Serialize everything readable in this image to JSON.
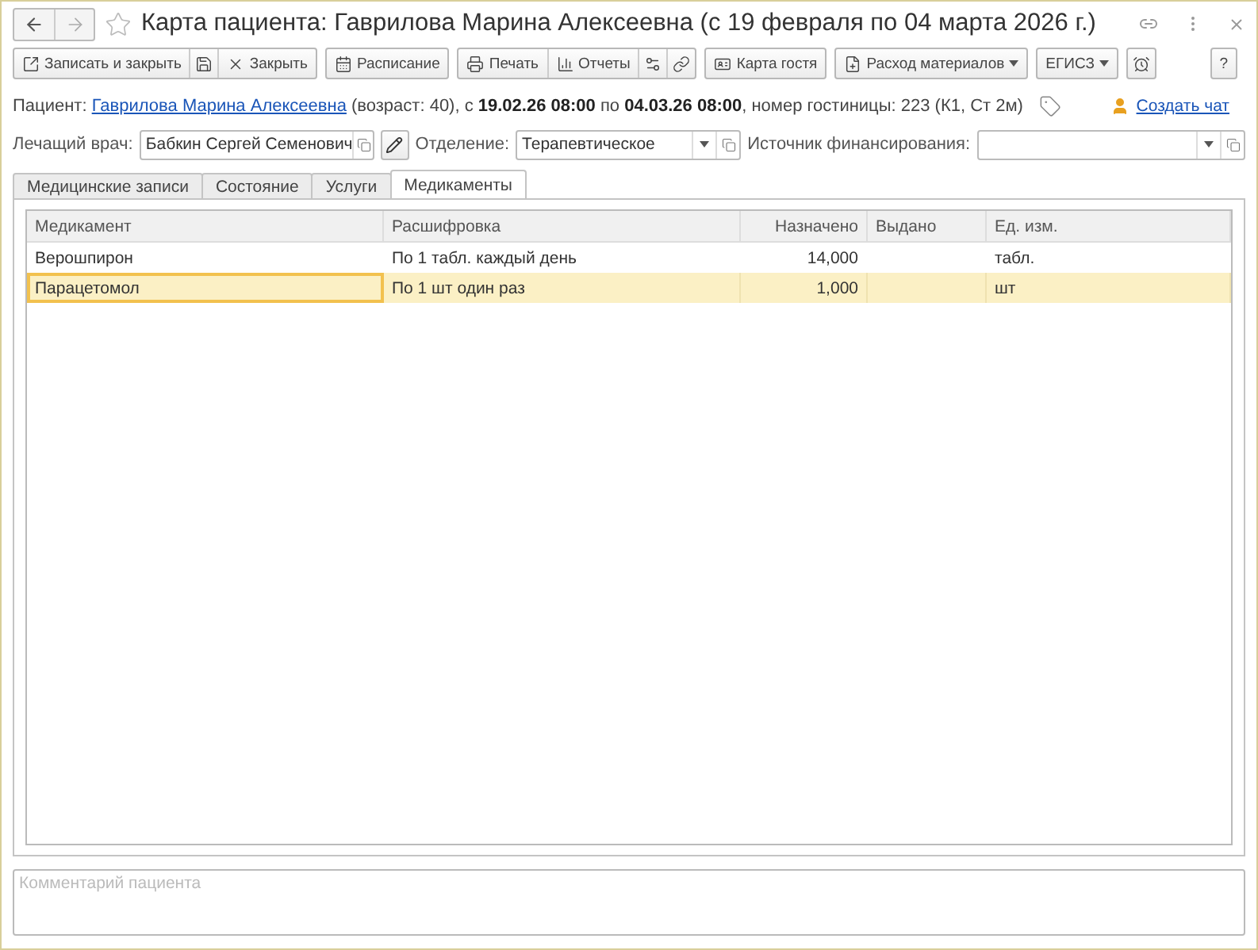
{
  "window": {
    "title": "Карта пациента: Гаврилова Марина Алексеевна (с 19 февраля по 04 марта 2026 г.)"
  },
  "toolbar": {
    "groups": [
      [
        {
          "kind": "button",
          "label": "Записать и закрыть"
        },
        {
          "kind": "icon"
        },
        {
          "kind": "button",
          "label": "Закрыть"
        }
      ],
      [
        {
          "kind": "button",
          "label": "Расписание"
        }
      ],
      [
        {
          "kind": "button",
          "label": "Печать"
        },
        {
          "kind": "button",
          "label": "Отчеты"
        },
        {
          "kind": "icon"
        },
        {
          "kind": "icon"
        }
      ],
      [
        {
          "kind": "button",
          "label": "Карта гостя"
        }
      ],
      [
        {
          "kind": "menu",
          "label": "Расход материалов"
        }
      ],
      [
        {
          "kind": "menu",
          "label": "ЕГИСЗ"
        }
      ],
      [
        {
          "kind": "icon"
        }
      ],
      [
        {
          "kind": "text",
          "label": "?"
        }
      ]
    ]
  },
  "patient": {
    "prefix": "Пациент:",
    "name": "Гаврилова Марина Алексеевна",
    "details": "(возраст: 40), с **19.02.26 08:00** по **04.03.26 08:00**, номер гостиницы: 223 (К1, Ст 2м)",
    "chat_link": "Создать чат"
  },
  "fields": [
    {
      "kind": "ref",
      "label": "Лечащий врач:",
      "value": "Бабкин Сергей Семенович"
    },
    {
      "kind": "select",
      "label": "Отделение:",
      "value": "Терапевтическое"
    },
    {
      "kind": "select",
      "label": "Источник финансирования:"
    }
  ],
  "tabs": [
    {
      "label": "Медицинские записи",
      "selected": false
    },
    {
      "label": "Состояние",
      "selected": false
    },
    {
      "label": "Услуги",
      "selected": false
    },
    {
      "label": "Медикаменты",
      "selected": true
    }
  ],
  "table": {
    "columns": [
      "Медикамент",
      "Расшифровка",
      "Назначено",
      "Выдано",
      "Ед. изм."
    ],
    "rows": [
      {
        "cells": [
          "Верошпирон",
          "По 1 табл. каждый день",
          "14,000",
          "",
          "табл."
        ],
        "selected": false
      },
      {
        "cells": [
          "Парацетомол",
          "По 1 шт один раз",
          "1,000",
          "",
          "шт"
        ],
        "selected": true
      }
    ]
  },
  "comment": {
    "placeholder": "Комментарий пациента"
  }
}
